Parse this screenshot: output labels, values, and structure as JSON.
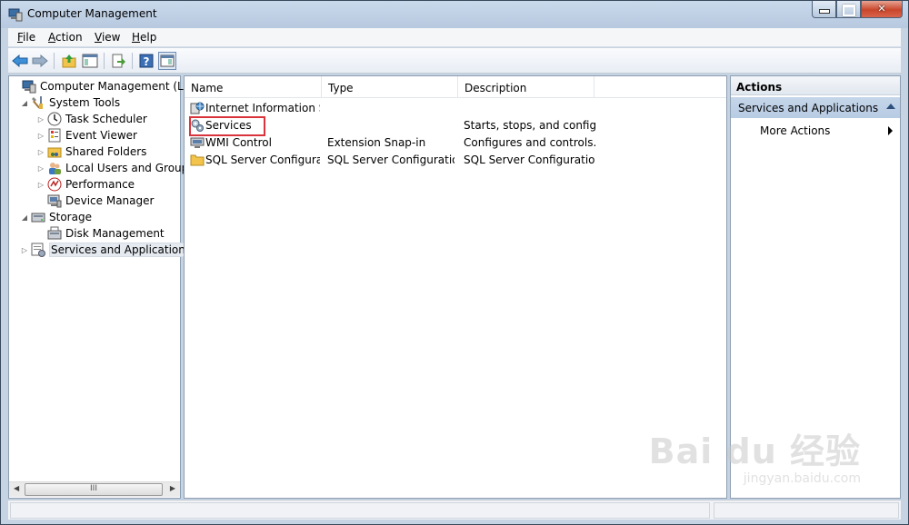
{
  "window": {
    "title": "Computer Management"
  },
  "menu": [
    {
      "key": "F",
      "rest": "ile"
    },
    {
      "key": "A",
      "rest": "ction"
    },
    {
      "key": "V",
      "rest": "iew"
    },
    {
      "key": "H",
      "rest": "elp"
    }
  ],
  "toolbar": [
    "back-icon",
    "forward-icon",
    "up-folder-icon",
    "show-hide-console-tree-icon",
    "export-list-icon",
    "help-icon",
    "show-hide-action-pane-icon"
  ],
  "tree": [
    {
      "label": "Computer Management (Local",
      "expander": "",
      "icon": "computer-management-icon"
    },
    {
      "label": "System Tools",
      "expander": "◢",
      "icon": "system-tools-icon"
    },
    {
      "label": "Task Scheduler",
      "expander": "▷",
      "icon": "task-scheduler-icon"
    },
    {
      "label": "Event Viewer",
      "expander": "▷",
      "icon": "event-viewer-icon"
    },
    {
      "label": "Shared Folders",
      "expander": "▷",
      "icon": "shared-folders-icon"
    },
    {
      "label": "Local Users and Groups",
      "expander": "▷",
      "icon": "local-users-icon"
    },
    {
      "label": "Performance",
      "expander": "▷",
      "icon": "performance-icon"
    },
    {
      "label": "Device Manager",
      "expander": "",
      "icon": "device-manager-icon"
    },
    {
      "label": "Storage",
      "expander": "◢",
      "icon": "storage-icon"
    },
    {
      "label": "Disk Management",
      "expander": "",
      "icon": "disk-management-icon"
    },
    {
      "label": "Services and Applications",
      "expander": "▷",
      "icon": "services-applications-icon"
    }
  ],
  "list": {
    "columns": [
      "Name",
      "Type",
      "Description"
    ],
    "rows": [
      {
        "name": "Internet Information S...",
        "type": "",
        "description": "",
        "icon": "iis-icon"
      },
      {
        "name": "Services",
        "type": "",
        "description": "Starts, stops, and config...",
        "icon": "services-icon"
      },
      {
        "name": "WMI Control",
        "type": "Extension Snap-in",
        "description": "Configures and controls...",
        "icon": "wmi-control-icon"
      },
      {
        "name": "SQL Server Configurat...",
        "type": "SQL Server Configuratio...",
        "description": "SQL Server Configuratio...",
        "icon": "folder-icon"
      }
    ]
  },
  "actions": {
    "header": "Actions",
    "section": "Services and Applications",
    "items": [
      {
        "label": "More Actions"
      }
    ]
  },
  "scrollbar": {
    "thumb_label": "III"
  },
  "watermark": {
    "main": "Bai du 经验",
    "sub": "jingyan.baidu.com"
  }
}
